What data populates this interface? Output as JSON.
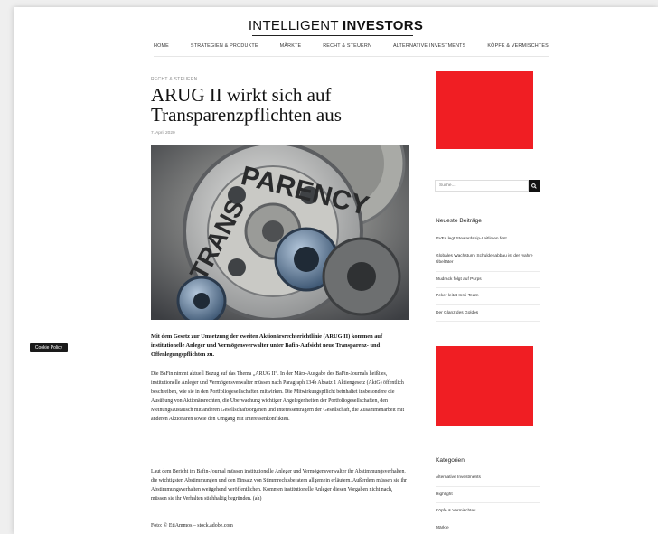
{
  "site": {
    "logo_left": "INTELLIGENT",
    "logo_right": "INVESTORS"
  },
  "nav": {
    "items": [
      "HOME",
      "STRATEGIEN & PRODUKTE",
      "MÄRKTE",
      "RECHT & STEUERN",
      "ALTERNATIVE INVESTMENTS",
      "KÖPFE & VERMISCHTES"
    ]
  },
  "article": {
    "category": "RECHT & STEUERN",
    "title": "ARUG II wirkt sich auf Transparenzpflichten aus",
    "date": "7. April 2020",
    "hero_word_top": "PARENCY",
    "hero_word_left": "TRANS",
    "lead": "Mit dem Gesetz zur Umsetzung der zweiten Aktionärsrechterichtlinie (ARUG II) kommen auf institutionelle Anleger und Vermögensverwalter unter Bafin-Aufsicht neue Transparenz- und Offenlegungspflichten zu.",
    "paragraph1": "Die BaFin nimmt aktuell Bezug auf das Thema „ARUG II“. In der März-Ausgabe des BaFin-Journals heißt es, institutionelle Anleger und Vermögensverwalter müssen nach Paragraph 134b Absatz 1 Aktiengesetz (AktG) öffentlich beschreiben, wie sie in den Portfoliogesellschaften mitwirken. Die Mitwirkungspflicht beinhaltet insbesondere die Ausübung von Aktionärsrechten, die Überwachung wichtiger Angelegenheiten der Portfoliogesellschaften, den Meinungsaustausch mit anderen Gesellschaftsorganen und Interessenträgern der Gesellschaft, die Zusammenarbeit mit anderen Aktionären sowie den Umgang mit Interessenkonflikten.",
    "paragraph2": "Laut dem Bericht im Bafin-Journal müssen institutionelle Anleger und Vermögensverwalter ihr Abstimmungsverhalten, die wichtigsten Abstimmungen und den Einsatz von Stimmrechtsberatern allgemein erläutern. Außerdem müssen sie ihr Abstimmungsverhalten weitgehend veröffentlichen. Kommen institutionelle Anleger diesen Vorgaben nicht nach, müssen sie ihr Verhalten stichhaltig begründen. (ah)",
    "credit": "Foto: © EtiAmmos – stock.adobe.com"
  },
  "sidebar": {
    "search_placeholder": "Suche...",
    "search_icon": "magnifier-icon",
    "recent_heading": "Neueste Beiträge",
    "recent": [
      "DVFA legt Stewardship-Leitlinien fest",
      "Globales Wachstum: Schuldenabbau ist der wahre Übeltäter",
      "Mudrack folgt auf Purps",
      "Peker leitet Insti-Team",
      "Der Glanz des Goldes"
    ],
    "categories_heading": "Kategorien",
    "categories": [
      "Alternative Investments",
      "Highlight",
      "Köpfe & Vermischtes",
      "Märkte"
    ],
    "ad_color": "#f01e23"
  },
  "cookie": {
    "label": "Cookie Policy"
  }
}
